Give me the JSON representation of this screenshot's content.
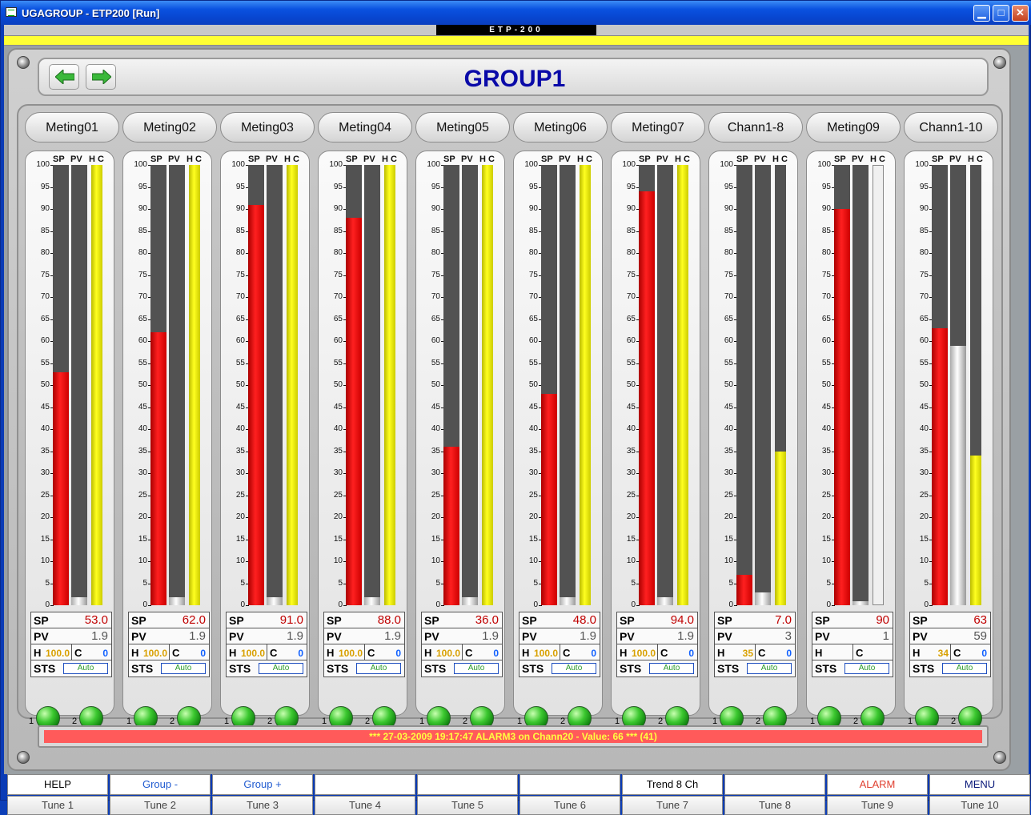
{
  "window": {
    "title": "UGAGROUP - ETP200 [Run]",
    "minimize": "▁",
    "maximize": "□",
    "close": "✕"
  },
  "device_label": "ETP-200",
  "page_title": "GROUP1",
  "colors": {
    "sp_bar": "#ff2020",
    "pv_bar": "#ffffff",
    "hc_bar": "#ffff20",
    "alarm_bg": "#ff5a5a",
    "alarm_text": "#ffff40",
    "title": "#0a0aa8"
  },
  "bar_headers": {
    "sp": "SP",
    "pv": "PV",
    "hc": "H C"
  },
  "ticks": [
    "100",
    "95",
    "90",
    "85",
    "80",
    "75",
    "70",
    "65",
    "60",
    "55",
    "50",
    "45",
    "40",
    "35",
    "30",
    "25",
    "20",
    "15",
    "10",
    "5",
    "0"
  ],
  "labels": {
    "sp": "SP",
    "pv": "PV",
    "h": "H",
    "c": "C",
    "sts": "STS",
    "led1": "1",
    "led2": "2"
  },
  "channels": [
    {
      "name": "Meting01",
      "sp": "53.0",
      "pv": "1.9",
      "h": "100.0",
      "c": "0",
      "sts": "Auto",
      "sp_pct": 53,
      "pv_pct": 1.9,
      "hc_pct": 100,
      "hc_empty": false
    },
    {
      "name": "Meting02",
      "sp": "62.0",
      "pv": "1.9",
      "h": "100.0",
      "c": "0",
      "sts": "Auto",
      "sp_pct": 62,
      "pv_pct": 1.9,
      "hc_pct": 100,
      "hc_empty": false
    },
    {
      "name": "Meting03",
      "sp": "91.0",
      "pv": "1.9",
      "h": "100.0",
      "c": "0",
      "sts": "Auto",
      "sp_pct": 91,
      "pv_pct": 1.9,
      "hc_pct": 100,
      "hc_empty": false
    },
    {
      "name": "Meting04",
      "sp": "88.0",
      "pv": "1.9",
      "h": "100.0",
      "c": "0",
      "sts": "Auto",
      "sp_pct": 88,
      "pv_pct": 1.9,
      "hc_pct": 100,
      "hc_empty": false
    },
    {
      "name": "Meting05",
      "sp": "36.0",
      "pv": "1.9",
      "h": "100.0",
      "c": "0",
      "sts": "Auto",
      "sp_pct": 36,
      "pv_pct": 1.9,
      "hc_pct": 100,
      "hc_empty": false
    },
    {
      "name": "Meting06",
      "sp": "48.0",
      "pv": "1.9",
      "h": "100.0",
      "c": "0",
      "sts": "Auto",
      "sp_pct": 48,
      "pv_pct": 1.9,
      "hc_pct": 100,
      "hc_empty": false
    },
    {
      "name": "Meting07",
      "sp": "94.0",
      "pv": "1.9",
      "h": "100.0",
      "c": "0",
      "sts": "Auto",
      "sp_pct": 94,
      "pv_pct": 1.9,
      "hc_pct": 100,
      "hc_empty": false
    },
    {
      "name": "Chann1-8",
      "sp": "7.0",
      "pv": "3",
      "h": "35",
      "c": "0",
      "sts": "Auto",
      "sp_pct": 7,
      "pv_pct": 3,
      "hc_pct": 35,
      "hc_empty": false
    },
    {
      "name": "Meting09",
      "sp": "90",
      "pv": "1",
      "h": "",
      "c": "",
      "sts": "Auto",
      "sp_pct": 90,
      "pv_pct": 1,
      "hc_pct": 100,
      "hc_empty": true
    },
    {
      "name": "Chann1-10",
      "sp": "63",
      "pv": "59",
      "h": "34",
      "c": "0",
      "sts": "Auto",
      "sp_pct": 63,
      "pv_pct": 59,
      "hc_pct": 34,
      "hc_empty": false
    }
  ],
  "alarm": "*** 27-03-2009 19:17:47   ALARM3 on Chann20 - Value: 66 *** (41)",
  "fkeys": [
    "HELP",
    "Group -",
    "Group +",
    "",
    "",
    "",
    "Trend 8 Ch",
    "",
    "ALARM",
    "MENU"
  ],
  "tunes": [
    "Tune 1",
    "Tune 2",
    "Tune 3",
    "Tune 4",
    "Tune 5",
    "Tune 6",
    "Tune 7",
    "Tune 8",
    "Tune 9",
    "Tune 10"
  ]
}
